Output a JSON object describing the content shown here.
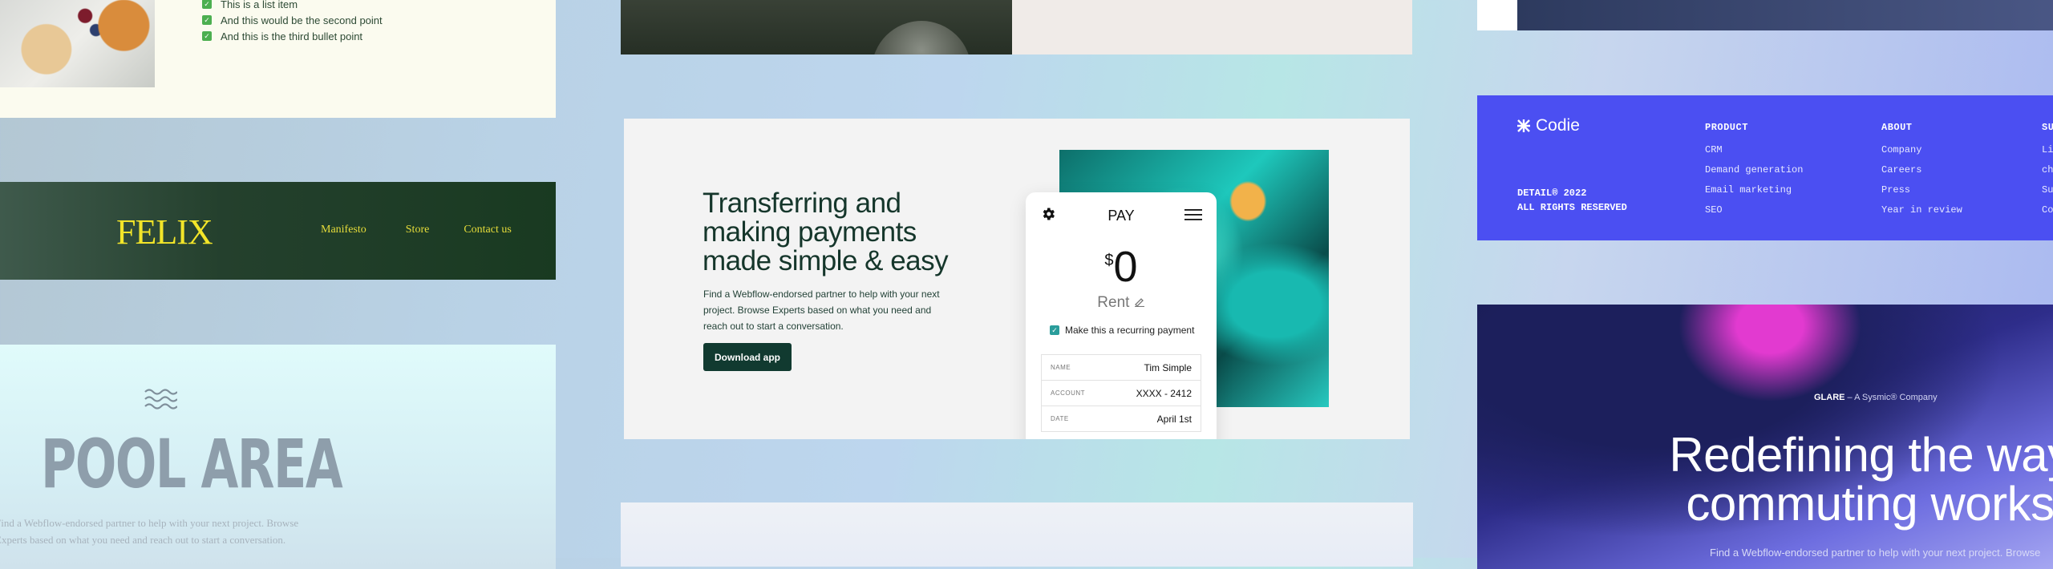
{
  "list_card": {
    "items": [
      "This is a list item",
      "And this would be the second point",
      "And this is the third bullet point"
    ]
  },
  "felix": {
    "logo": "FELIX",
    "nav": [
      "Manifesto",
      "Store",
      "Contact us"
    ]
  },
  "pool": {
    "title": "POOL AREA",
    "description": "Find a Webflow-endorsed partner to help with your next project. Browse Experts based on what you need and reach out to start a conversation."
  },
  "pay_hero": {
    "title": "Transferring and making payments made simple & easy",
    "description": "Find a Webflow-endorsed partner to help with your next project. Browse Experts based on what you need and reach out to start a conversation.",
    "cta": "Download app"
  },
  "phone": {
    "header": "PAY",
    "currency": "$",
    "amount": "0",
    "category": "Rent",
    "recurring_label": "Make this a recurring payment",
    "rows": [
      {
        "key": "NAME",
        "value": "Tim Simple"
      },
      {
        "key": "ACCOUNT",
        "value": "XXXX - 2412"
      },
      {
        "key": "DATE",
        "value": "April 1st"
      }
    ]
  },
  "codie": {
    "logo": "Codie",
    "copyright_line1": "DETAIL® 2022",
    "copyright_line2": "ALL RIGHTS RESERVED",
    "columns": [
      {
        "heading": "PRODUCT",
        "items": [
          "CRM",
          "Demand generation",
          "Email marketing",
          "SEO"
        ]
      },
      {
        "heading": "ABOUT",
        "items": [
          "Company",
          "Careers",
          "Press",
          "Year in review"
        ]
      },
      {
        "heading": "SUPPORT",
        "items": [
          "Live chat",
          "Support",
          "Contact"
        ]
      }
    ]
  },
  "glare": {
    "tag_brand": "GLARE",
    "tag_rest": " – A Sysmic® Company",
    "headline_line1": "Redefining the way",
    "headline_line2": "commuting works",
    "subtext": "Find a Webflow-endorsed partner to help with your next project. Browse"
  }
}
